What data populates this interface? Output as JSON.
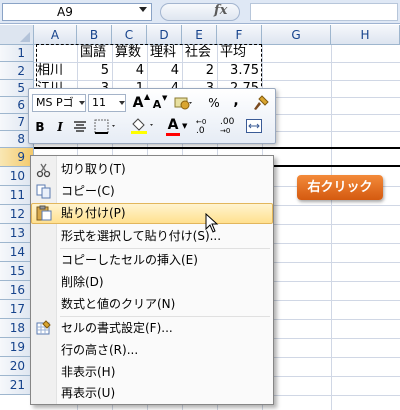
{
  "formula_bar": {
    "cell_ref": "A9",
    "fx": "fx",
    "formula": ""
  },
  "columns": [
    "A",
    "B",
    "C",
    "D",
    "E",
    "F",
    "G",
    "H"
  ],
  "rows": [
    "1",
    "2",
    "5",
    "6",
    "7",
    "8",
    "9",
    "10",
    "11",
    "12",
    "13",
    "14",
    "15",
    "16",
    "17",
    "18",
    "19",
    "20",
    "21"
  ],
  "cells": {
    "header": [
      "",
      "国語",
      "算数",
      "理科",
      "社会",
      "平均"
    ],
    "r2": [
      "相川",
      "5",
      "4",
      "4",
      "2",
      "3.75"
    ],
    "r5": [
      "江川",
      "3",
      "1",
      "4",
      "3",
      "2.75"
    ]
  },
  "mini_toolbar": {
    "font_name": "MS Pゴ",
    "font_size": "11",
    "grow_font": "A",
    "shrink_font": "A",
    "percent": "%",
    "comma": ",",
    "bold": "B",
    "italic": "I",
    "font_color": "A",
    "inc_decimal": ".0",
    "dec_decimal": ".00"
  },
  "context_menu": {
    "items": [
      {
        "label": "切り取り(T)"
      },
      {
        "label": "コピー(C)"
      },
      {
        "label": "貼り付け(P)"
      },
      {
        "label": "形式を選択して貼り付け(S)..."
      },
      {
        "label": "コピーしたセルの挿入(E)"
      },
      {
        "label": "削除(D)"
      },
      {
        "label": "数式と値のクリア(N)"
      },
      {
        "label": "セルの書式設定(F)..."
      },
      {
        "label": "行の高さ(R)..."
      },
      {
        "label": "非表示(H)"
      },
      {
        "label": "再表示(U)"
      }
    ]
  },
  "callout": {
    "label": "右クリック"
  },
  "colors": {
    "callout": "#e06a1e",
    "highlight": "#ffe08f",
    "header_text": "#15428b"
  }
}
